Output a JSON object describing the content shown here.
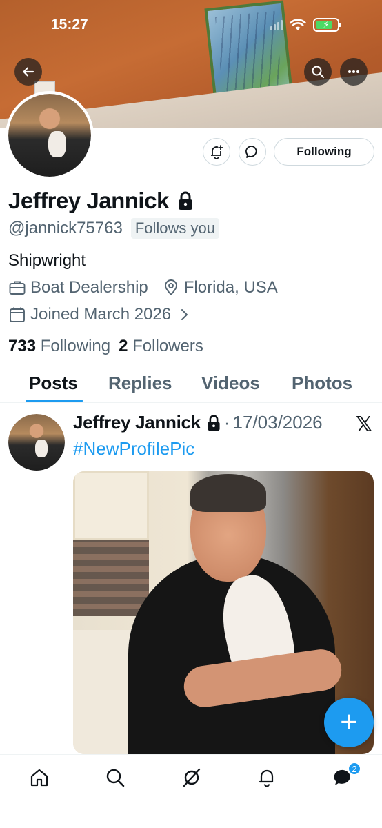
{
  "status_bar": {
    "time": "15:27"
  },
  "profile": {
    "name": "Jeffrey Jannick",
    "handle": "@jannick75763",
    "follows_you": "Follows you",
    "bio": "Shipwright",
    "category": "Boat Dealership",
    "location": "Florida, USA",
    "joined": "Joined March 2026",
    "following_count": "733",
    "following_label": "Following",
    "followers_count": "2",
    "followers_label": "Followers"
  },
  "actions": {
    "following_button": "Following"
  },
  "tabs": [
    {
      "label": "Posts",
      "active": true
    },
    {
      "label": "Replies",
      "active": false
    },
    {
      "label": "Videos",
      "active": false
    },
    {
      "label": "Photos",
      "active": false
    }
  ],
  "post": {
    "author": "Jeffrey Jannick",
    "separator": "·",
    "date": "17/03/2026",
    "source_logo": "𝕏",
    "text": "#NewProfilePic"
  },
  "fab": {
    "label": "+"
  },
  "bottom_nav": {
    "items": [
      "home-icon",
      "search-icon",
      "grok-icon",
      "notifications-icon",
      "messages-icon"
    ],
    "messages_badge": "2"
  },
  "colors": {
    "accent": "#1d9bf0",
    "text": "#0f1419",
    "secondary": "#536471"
  }
}
